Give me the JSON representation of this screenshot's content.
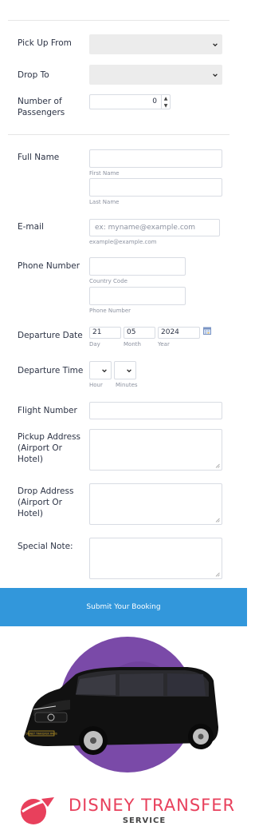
{
  "form": {
    "pickup_label": "Pick Up From",
    "drop_label": "Drop To",
    "passengers_label": "Number of Passengers",
    "passengers_value": "0",
    "full_name_label": "Full Name",
    "first_name_sub": "First Name",
    "last_name_sub": "Last Name",
    "email_label": "E-mail",
    "email_placeholder": "ex: myname@example.com",
    "email_sub": "example@example.com",
    "phone_label": "Phone Number",
    "country_code_sub": "Country Code",
    "phone_sub": "Phone Number",
    "departure_date_label": "Departure Date",
    "date_day": "21",
    "date_month": "05",
    "date_year": "2024",
    "day_sub": "Day",
    "month_sub": "Month",
    "year_sub": "Year",
    "departure_time_label": "Departure Time",
    "hour_sub": "Hour",
    "minutes_sub": "Minutes",
    "flight_label": "Flight Number",
    "pickup_address_label": "Pickup Address (Airport Or Hotel)",
    "drop_address_label": "Drop Address (Airport Or Hotel)",
    "note_label": "Special Note:",
    "submit_label": "Submit Your Booking"
  },
  "brand": {
    "name_line1": "DISNEY TRANSFER",
    "name_line2": "SERVICE",
    "plate_text": "DISNEY TRANSFER PARIS",
    "accent_color": "#e8405c",
    "purple_color": "#7a4aa8",
    "button_color": "#3297db"
  },
  "icons": [
    "chevron-down-icon",
    "calendar-icon",
    "spinner-arrows-icon",
    "resize-handle-icon",
    "paper-plane-logo-icon"
  ]
}
